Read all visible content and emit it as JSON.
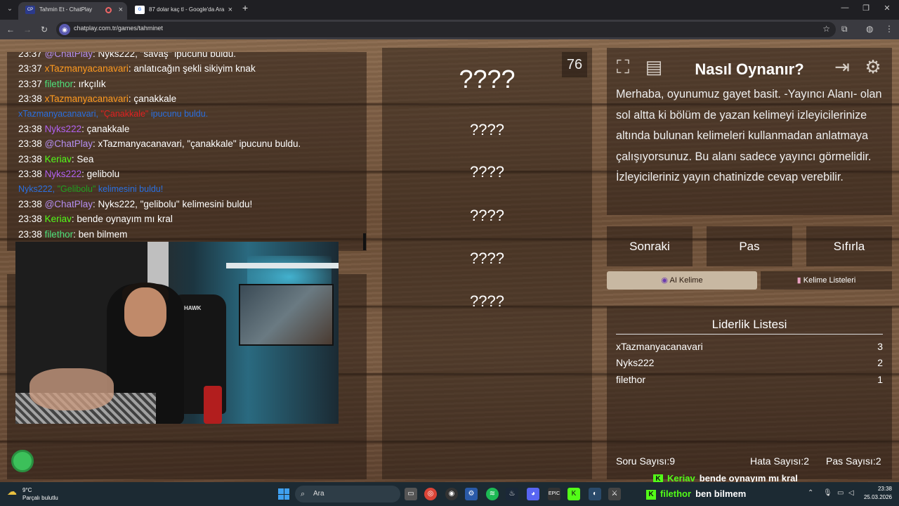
{
  "browser": {
    "tabs": [
      {
        "title": "Tahmin Et - ChatPlay",
        "favicon": "CP"
      },
      {
        "title": "87 dolar kaç tl - Google'da Ara",
        "favicon": "G"
      }
    ],
    "url": "chatplay.com.tr/games/tahminet"
  },
  "chat": {
    "lines": [
      {
        "time": "23:37",
        "user": "@ChatPlay",
        "user_color": "#b48ef0",
        "text": ": Nyks222, \"savaş\" ipucunu buldu."
      },
      {
        "time": "23:37",
        "user": "xTazmanyacanavari",
        "user_color": "#ff9a1f",
        "text": ": anlatıcağın şekli sikiyim knak"
      },
      {
        "time": "23:37",
        "user": "filethor",
        "user_color": "#4de07a",
        "text": ": ırkçılık"
      },
      {
        "time": "23:38",
        "user": "xTazmanyacanavari",
        "user_color": "#ff9a1f",
        "text": ": çanakkale"
      },
      {
        "system": true,
        "parts": [
          {
            "text": "xTazmanyacanavari, ",
            "color": "#2a6fe0"
          },
          {
            "text": "\"Çanakkale\"",
            "color": "#e02020"
          },
          {
            "text": " ipucunu buldu.",
            "color": "#2a6fe0"
          }
        ]
      },
      {
        "time": "23:38",
        "user": "Nyks222",
        "user_color": "#b060f0",
        "text": ": çanakkale"
      },
      {
        "time": "23:38",
        "user": "@ChatPlay",
        "user_color": "#b48ef0",
        "text": ": xTazmanyacanavari, \"çanakkale\" ipucunu buldu."
      },
      {
        "time": "23:38",
        "user": "Keriav",
        "user_color": "#53fc18",
        "text": ": Sea"
      },
      {
        "time": "23:38",
        "user": "Nyks222",
        "user_color": "#b060f0",
        "text": ": gelibolu"
      },
      {
        "system": true,
        "parts": [
          {
            "text": "Nyks222, ",
            "color": "#2a6fe0"
          },
          {
            "text": "\"Gelibolu\"",
            "color": "#20a020"
          },
          {
            "text": " kelimesini buldu!",
            "color": "#2a6fe0"
          }
        ]
      },
      {
        "time": "23:38",
        "user": "@ChatPlay",
        "user_color": "#b48ef0",
        "text": ": Nyks222, \"gelibolu\" kelimesini buldu!"
      },
      {
        "time": "23:38",
        "user": "Keriav",
        "user_color": "#53fc18",
        "text": ": bende oynayım mı kral"
      },
      {
        "time": "23:38",
        "user": "filethor",
        "user_color": "#4de07a",
        "text": ": ben bilmem"
      }
    ]
  },
  "words": {
    "main": "????",
    "hidden": [
      "????",
      "????",
      "????",
      "????",
      "????"
    ]
  },
  "timer": "76",
  "howto": {
    "title": "Nasıl Oynanır?",
    "text": "Merhaba, oyunumuz gayet basit. -Yayıncı Alanı- olan sol altta ki bölüm de yazan kelimeyi izleyicilerinize altında bulunan kelimeleri kullanmadan anlatmaya çalışıyorsunuz. Bu alanı sadece yayıncı görmelidir. İzleyicileriniz yayın chatinizde cevap verebilir."
  },
  "controls": {
    "next": "Sonraki",
    "pass": "Pas",
    "reset": "Sıfırla"
  },
  "mode_tabs": {
    "ai": "AI Kelime",
    "lists": "Kelime Listeleri"
  },
  "leaderboard": {
    "title": "Liderlik Listesi",
    "rows": [
      {
        "name": "xTazmanyacanavari",
        "score": "3"
      },
      {
        "name": "Nyks222",
        "score": "2"
      },
      {
        "name": "filethor",
        "score": "1"
      }
    ]
  },
  "stats": {
    "questions_label": "Soru Sayısı:",
    "questions": "9",
    "errors_label": "Hata Sayısı:",
    "errors": "2",
    "passes_label": "Pas Sayısı:",
    "passes": "2"
  },
  "overlay_chat": [
    {
      "badge": "K",
      "user": "Keriav",
      "text": "bende oynayım mı kral"
    },
    {
      "badge": "K",
      "user": "filethor",
      "text": "ben bilmem"
    }
  ],
  "cam": {
    "chair_logo": "HAWK"
  },
  "taskbar": {
    "weather_temp": "9°C",
    "weather_desc": "Parçalı bulutlu",
    "search_placeholder": "Ara",
    "time": "23:38",
    "date": "25.03.2026"
  },
  "colors": {
    "accent_green": "#53fc18",
    "system_blue": "#2a6fe0"
  }
}
